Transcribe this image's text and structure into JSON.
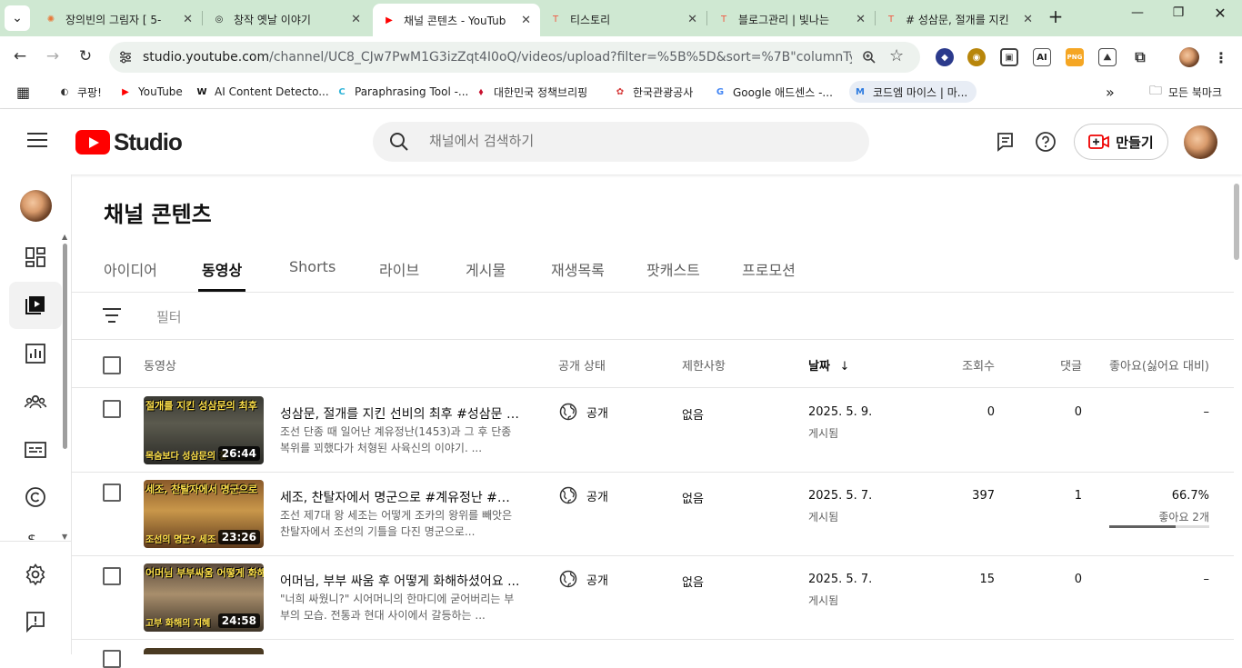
{
  "browser": {
    "tabs": [
      {
        "title": "장의빈의 그림자 [ 5-",
        "fav": "✺",
        "favcolor": "#e8793a"
      },
      {
        "title": "창작 옛날 이야기",
        "fav": "◎",
        "favcolor": "#222222"
      },
      {
        "title": "채널 콘텐츠 - YouTub",
        "fav": "▶",
        "favcolor": "#ff0000"
      },
      {
        "title": "티스토리",
        "fav": "T",
        "favcolor": "#f05a43"
      },
      {
        "title": "블로그관리 | 빛나는",
        "fav": "T",
        "favcolor": "#f05a43"
      },
      {
        "title": "# 성삼문, 절개를 지킨",
        "fav": "T",
        "favcolor": "#f05a43"
      }
    ],
    "new_tab": "+",
    "url_host": "studio.youtube.com",
    "url_path": "/channel/UC8_CJw7PwM1G3izZqt4I0oQ/videos/upload?filter=%5B%5D&sort=%7B\"columnType\"%3A...",
    "bookmarks": [
      {
        "label": "쿠팡!",
        "icon": "◐",
        "color": "#333333"
      },
      {
        "label": "YouTube",
        "icon": "▶",
        "color": "#ff0000"
      },
      {
        "label": "AI Content Detecto...",
        "icon": "W",
        "color": "#111111"
      },
      {
        "label": "Paraphrasing Tool -...",
        "icon": "C",
        "color": "#2fb4d8"
      },
      {
        "label": "대한민국 정책브리핑",
        "icon": "⬧",
        "color": "#c8102e"
      },
      {
        "label": "한국관광공사",
        "icon": "✿",
        "color": "#d63b3b"
      },
      {
        "label": "Google 애드센스 -...",
        "icon": "G",
        "color": "#4285f4"
      },
      {
        "label": "코드엠 마이스 | 마...",
        "icon": "M",
        "color": "#2d7be0"
      }
    ],
    "more_bookmarks": "»",
    "all_bookmarks": "모든 북마크"
  },
  "header": {
    "logo_text": "Studio",
    "search_placeholder": "채널에서 검색하기",
    "create_label": "만들기"
  },
  "page": {
    "title": "채널 콘텐츠",
    "tabs": [
      "아이디어",
      "동영상",
      "Shorts",
      "라이브",
      "게시물",
      "재생목록",
      "팟캐스트",
      "프로모션"
    ],
    "active_tab": "동영상",
    "filter_placeholder": "필터"
  },
  "table": {
    "headers": {
      "video": "동영상",
      "visibility": "공개 상태",
      "restrictions": "제한사항",
      "date": "날짜",
      "views": "조회수",
      "comments": "댓글",
      "likes": "좋아요(싫어요 대비)"
    },
    "sort_icon": "↓",
    "rows": [
      {
        "title": "성삼문, 절개를 지킨 선비의 최후 #성삼문 #...",
        "desc": "조선 단종 때 일어난 계유정난(1453)과 그 후 단종복위를 꾀했다가 처형된 사육신의 이야기. ...",
        "duration": "26:44",
        "thumb_cap": "절개를 지킨 성삼문의 최후",
        "thumb_cap2": "목숨보다 성삼문의 절",
        "visibility": "공개",
        "restrictions": "없음",
        "date": "2025. 5. 9.",
        "date_sub": "게시됨",
        "views": "0",
        "comments": "0",
        "likes": "–",
        "likes_sub": "",
        "like_ratio": null
      },
      {
        "title": "세조, 찬탈자에서 명군으로 #계유정난 #수...",
        "desc": "조선 제7대 왕 세조는 어떻게 조카의 왕위를 빼앗은 찬탈자에서 조선의 기틀을 다진 명군으로...",
        "duration": "23:26",
        "thumb_cap": "세조, 찬탈자에서 명군으로",
        "thumb_cap2": "조선의 명군? 세조",
        "visibility": "공개",
        "restrictions": "없음",
        "date": "2025. 5. 7.",
        "date_sub": "게시됨",
        "views": "397",
        "comments": "1",
        "likes": "66.7%",
        "likes_sub": "좋아요 2개",
        "like_ratio": 0.667
      },
      {
        "title": "어머님, 부부 싸움 후 어떻게 화해하셨어요 ...",
        "desc": "\"너희 싸웠니?\" 시어머니의 한마디에 굳어버리는 부부의 모습. 전통과 현대 사이에서 갈등하는 ...",
        "duration": "24:58",
        "thumb_cap": "어머님 부부싸움 어떻게 화해",
        "thumb_cap2": "고부 화해의 지혜",
        "visibility": "공개",
        "restrictions": "없음",
        "date": "2025. 5. 7.",
        "date_sub": "게시됨",
        "views": "15",
        "comments": "0",
        "likes": "–",
        "likes_sub": "",
        "like_ratio": null
      }
    ]
  }
}
